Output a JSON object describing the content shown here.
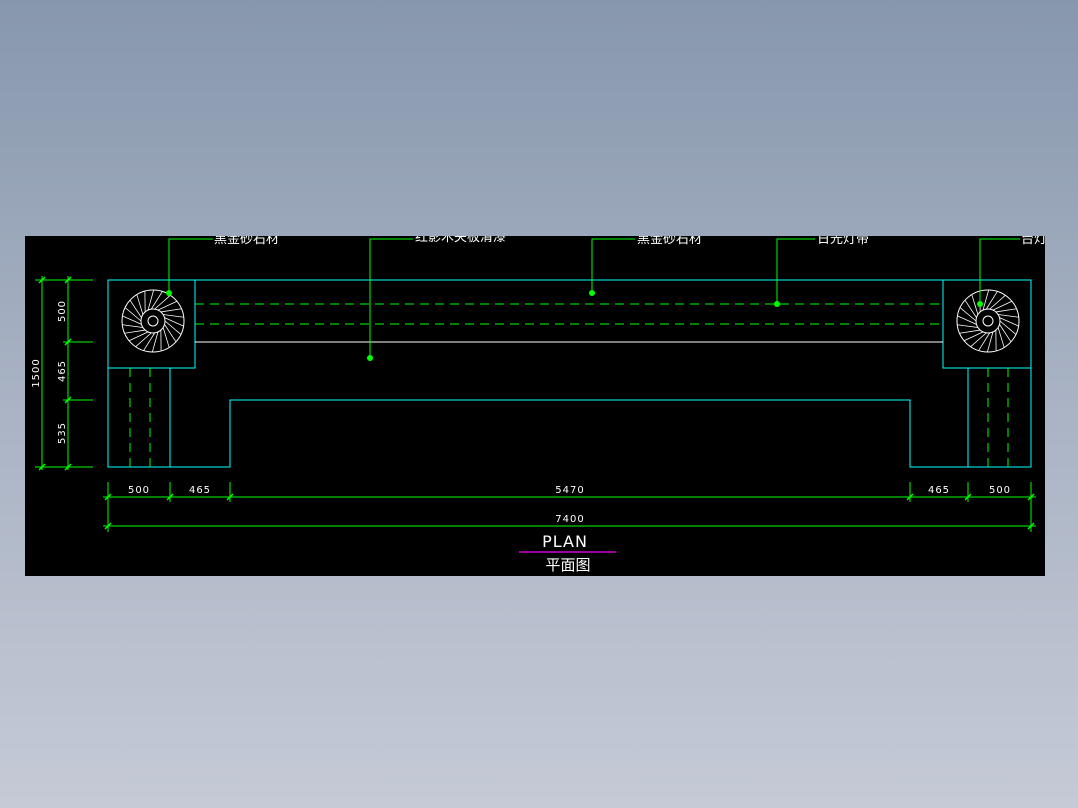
{
  "drawing": {
    "callouts": [
      {
        "id": "stone-left",
        "text": "黑金砂石材"
      },
      {
        "id": "veneer",
        "text": "红影木夹板清漆"
      },
      {
        "id": "stone-top",
        "text": "黑金砂石材"
      },
      {
        "id": "led-strip",
        "text": "日光灯带"
      },
      {
        "id": "table-lamp",
        "text": "台灯"
      }
    ],
    "dimensions": {
      "horizontal": [
        "500",
        "465",
        "5470",
        "465",
        "500"
      ],
      "overall": "7400",
      "vertical": [
        "500",
        "465",
        "535"
      ],
      "vertical_total": "1500"
    },
    "title": {
      "en": "PLAN",
      "cn": "平面图"
    },
    "colors": {
      "outline": "#00ffff",
      "leader": "#00ff00",
      "dimension": "#00ff00",
      "title_underline": "#ff00ff",
      "background": "#000000",
      "text": "#ffffff"
    }
  }
}
